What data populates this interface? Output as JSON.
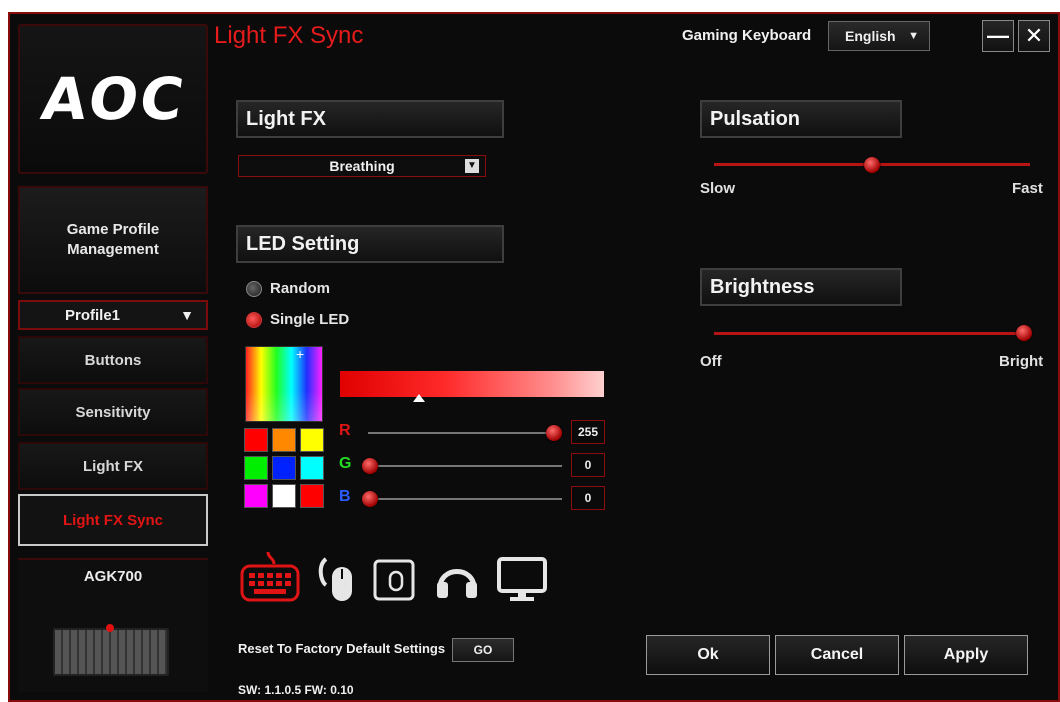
{
  "sidebar": {
    "logo_text": "AOC",
    "game_profile_line1": "Game Profile",
    "game_profile_line2": "Management",
    "profile_value": "Profile1",
    "nav": [
      "Buttons",
      "Sensitivity",
      "Light FX",
      "Light FX Sync"
    ],
    "active_nav": "Light FX Sync",
    "device_name": "AGK700"
  },
  "header": {
    "title": "Light FX Sync",
    "device_label": "Gaming Keyboard",
    "language": "English",
    "minimize": "—",
    "close": "✕"
  },
  "light_fx": {
    "header": "Light FX",
    "selected": "Breathing"
  },
  "led_setting": {
    "header": "LED Setting",
    "random_label": "Random",
    "single_label": "Single LED",
    "selected_mode": "Single LED",
    "swatches": [
      "#ff0000",
      "#ff8800",
      "#ffff00",
      "#00ee00",
      "#0022ff",
      "#00ffff",
      "#ff00ff",
      "#ffffff",
      "#ff0000"
    ],
    "channels": [
      {
        "label": "R",
        "value": "255",
        "color": "#e01414",
        "fraction": 1.0
      },
      {
        "label": "G",
        "value": "0",
        "color": "#22dd22",
        "fraction": 0.0
      },
      {
        "label": "B",
        "value": "0",
        "color": "#2a5cff",
        "fraction": 0.0
      }
    ]
  },
  "pulsation": {
    "header": "Pulsation",
    "min_label": "Slow",
    "max_label": "Fast",
    "fraction": 0.5
  },
  "brightness": {
    "header": "Brightness",
    "min_label": "Off",
    "max_label": "Bright",
    "fraction": 1.0
  },
  "devices": [
    "keyboard-icon",
    "mouse-icon",
    "mousepad-icon",
    "headset-icon",
    "monitor-icon"
  ],
  "footer": {
    "reset_label": "Reset To Factory Default Settings",
    "go_label": "GO",
    "version": "SW: 1.1.0.5   FW: 0.10",
    "ok": "Ok",
    "cancel": "Cancel",
    "apply": "Apply"
  },
  "colors": {
    "accent": "#e61b1b",
    "border_red": "#8a0d0d",
    "background": "#0b0b0b"
  }
}
